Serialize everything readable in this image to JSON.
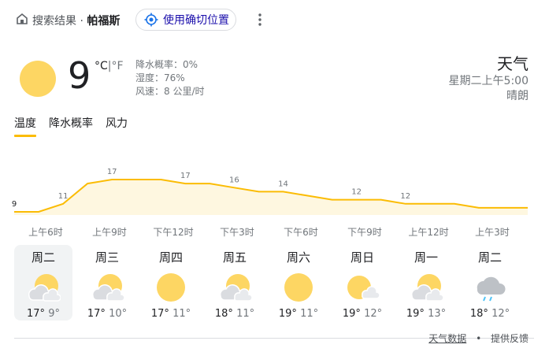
{
  "breadcrumb": {
    "prefix": "搜索结果 · ",
    "place": "帕福斯"
  },
  "location_button": "使用确切位置",
  "current": {
    "temp": "9",
    "unit_c": "°C",
    "separator": "|",
    "unit_f": "°F",
    "precip": "降水概率：0%",
    "humidity": "湿度：76%",
    "wind": "风速：8 公里/时",
    "condition_icon": "sun-icon"
  },
  "header_right": {
    "title": "天气",
    "datetime": "星期二上午5:00",
    "condition": "晴朗"
  },
  "tabs": [
    "温度",
    "降水概率",
    "风力"
  ],
  "chart_data": {
    "type": "area",
    "x": [
      "上午3时",
      "上午6时",
      "上午9时",
      "中午",
      "下午3时",
      "下午6时",
      "下午9时",
      "上午12时",
      "上午3时",
      "上午6时",
      "上午9时",
      "中午",
      "下午3时",
      "下午6时",
      "下午9时",
      "上午12时",
      "上午3时",
      "上午6时",
      "上午9时",
      "中午",
      "下午3时",
      "下午6时",
      "下午9时",
      "上午12时",
      "上午3时"
    ],
    "values": [
      9,
      9,
      11,
      16,
      17,
      17,
      17,
      16,
      16,
      15,
      14,
      14,
      13,
      12,
      12,
      12,
      11,
      11,
      11,
      10,
      10,
      10
    ],
    "labels": [
      {
        "index": 0,
        "text": "9"
      },
      {
        "index": 2,
        "text": "11"
      },
      {
        "index": 4,
        "text": "17"
      },
      {
        "index": 7,
        "text": "17"
      },
      {
        "index": 9,
        "text": "16"
      },
      {
        "index": 11,
        "text": "14"
      },
      {
        "index": 14,
        "text": "12"
      },
      {
        "index": 16,
        "text": "12"
      }
    ],
    "series_color": "#fbbc04",
    "fill_color": "#fef7e0"
  },
  "time_labels": [
    "上午6时",
    "上午9时",
    "下午12时",
    "下午3时",
    "下午6时",
    "下午9时",
    "上午12时",
    "上午3时"
  ],
  "days": [
    {
      "name": "周二",
      "icon": "partly-cloudy-icon",
      "high": "17°",
      "low": "9°",
      "selected": true
    },
    {
      "name": "周三",
      "icon": "partly-cloudy-icon",
      "high": "17°",
      "low": "10°"
    },
    {
      "name": "周四",
      "icon": "sun-icon",
      "high": "17°",
      "low": "11°"
    },
    {
      "name": "周五",
      "icon": "partly-cloudy-icon",
      "high": "18°",
      "low": "11°"
    },
    {
      "name": "周六",
      "icon": "sun-icon",
      "high": "19°",
      "low": "11°"
    },
    {
      "name": "周日",
      "icon": "sun-cloud-icon",
      "high": "19°",
      "low": "12°"
    },
    {
      "name": "周一",
      "icon": "partly-cloudy-icon",
      "high": "19°",
      "low": "13°"
    },
    {
      "name": "周二",
      "icon": "rain-icon",
      "high": "18°",
      "low": "12°"
    }
  ],
  "footer": {
    "source": "天气数据",
    "dot": "•",
    "feedback": "提供反馈"
  }
}
